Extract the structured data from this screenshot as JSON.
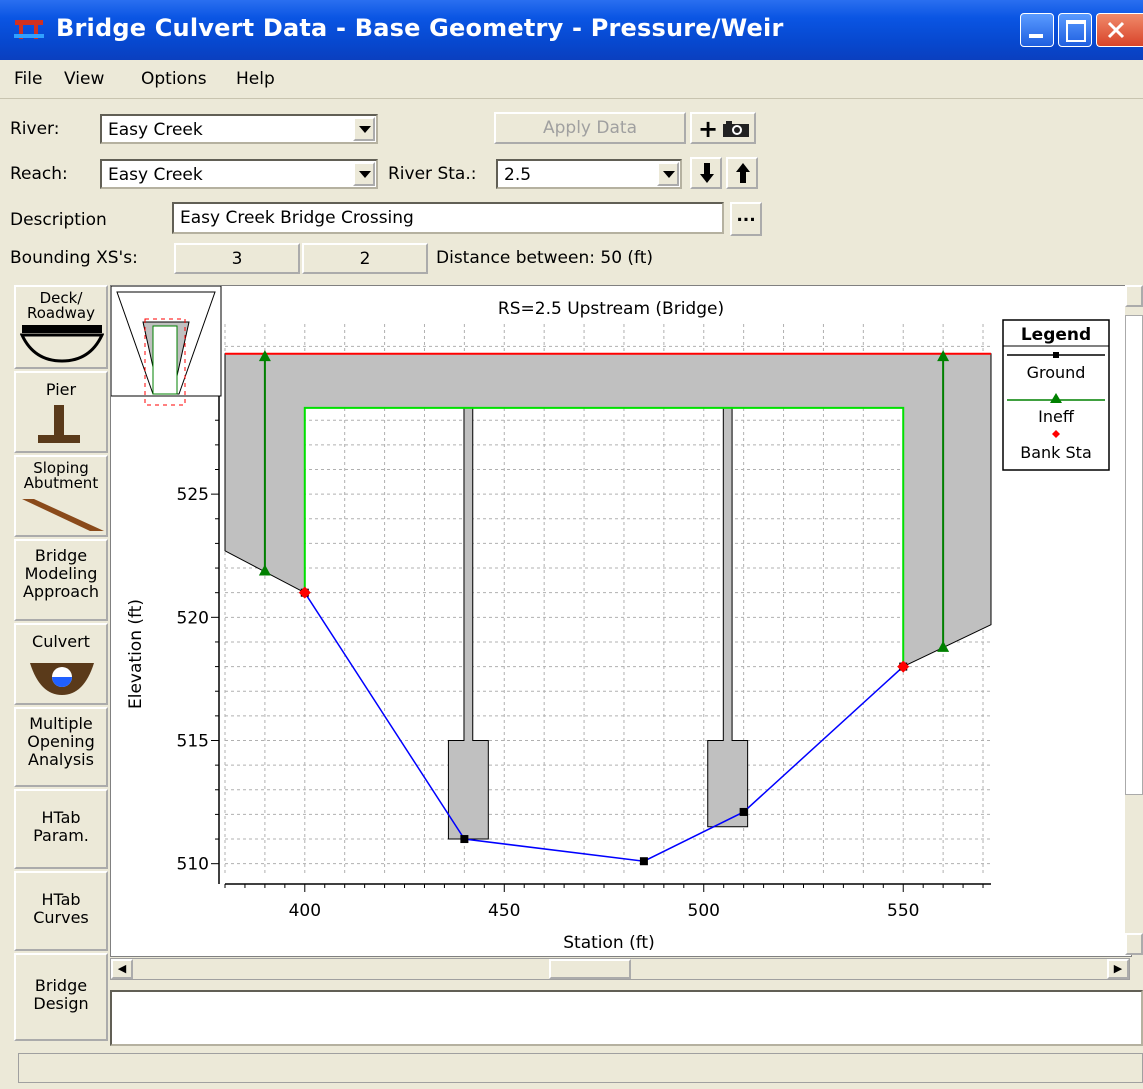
{
  "window": {
    "title": "Bridge Culvert Data - Base Geometry - Pressure/Weir"
  },
  "menu": [
    "File",
    "View",
    "Options",
    "Help"
  ],
  "form": {
    "river_label": "River:",
    "river_value": "Easy Creek",
    "apply_button": "Apply Data",
    "reach_label": "Reach:",
    "reach_value": "Easy Creek",
    "river_sta_label": "River Sta.:",
    "river_sta_value": "2.5",
    "description_label": "Description",
    "description_value": "Easy Creek Bridge Crossing",
    "ellipsis_button": "...",
    "bounding_label": "Bounding XS's:",
    "bounding_us": "3",
    "bounding_ds": "2",
    "distance_text": "Distance between: 50 (ft)"
  },
  "tabs": [
    {
      "label": "Deck/\nRoadway",
      "icon": "deck-icon"
    },
    {
      "label": "Pier",
      "icon": "pier-icon"
    },
    {
      "label": "Sloping\nAbutment",
      "icon": "abutment-icon"
    },
    {
      "label": "Bridge\nModeling\nApproach",
      "icon": ""
    },
    {
      "label": "Culvert",
      "icon": "culvert-icon"
    },
    {
      "label": "Multiple\nOpening\nAnalysis",
      "icon": ""
    },
    {
      "label": "HTab\nParam.",
      "icon": ""
    },
    {
      "label": "HTab\nCurves",
      "icon": ""
    },
    {
      "label": "Bridge\nDesign",
      "icon": ""
    }
  ],
  "chart_data": {
    "type": "line",
    "title": "RS=2.5    Upstream  (Bridge)",
    "xlabel": "Station (ft)",
    "ylabel": "Elevation (ft)",
    "xlim": [
      380,
      572
    ],
    "ylim": [
      509.5,
      531.5
    ],
    "xticks": [
      400,
      450,
      500,
      550
    ],
    "yticks": [
      510,
      515,
      520,
      525
    ],
    "grid": true,
    "legend_position": "right",
    "legend_title": "Legend",
    "series": [
      {
        "name": "Ground",
        "color": "#0000ff",
        "marker": "square",
        "x": [
          400,
          440,
          485,
          510,
          550
        ],
        "y": [
          521.0,
          511.0,
          510.1,
          512.1,
          518.0
        ]
      },
      {
        "name": "Ineff",
        "color": "#008000",
        "marker": "triangle",
        "x": [
          390,
          390,
          560,
          560
        ],
        "y": [
          521.9,
          530.6,
          518.8,
          530.6
        ]
      },
      {
        "name": "Bank Sta",
        "color": "#ff0000",
        "marker": "diamond",
        "x": [
          400,
          550
        ],
        "y": [
          521.0,
          518.0
        ]
      }
    ],
    "deck": {
      "high_chord": 530.7,
      "low_chord": 528.5,
      "left_ground": [
        [
          380,
          522.7
        ],
        [
          400,
          521.0
        ]
      ],
      "right_ground": [
        [
          550,
          518.0
        ],
        [
          572,
          519.7
        ]
      ],
      "opening_left": 400,
      "opening_right": 550
    },
    "piers": [
      {
        "center": 441,
        "width_top": 2.2,
        "footing_left": 436,
        "footing_right": 446,
        "footing_top": 515.0,
        "footing_bottom": 511.0
      },
      {
        "center": 506,
        "width_top": 2.2,
        "footing_left": 501,
        "footing_right": 511,
        "footing_top": 515.0,
        "footing_bottom": 511.5
      }
    ]
  }
}
